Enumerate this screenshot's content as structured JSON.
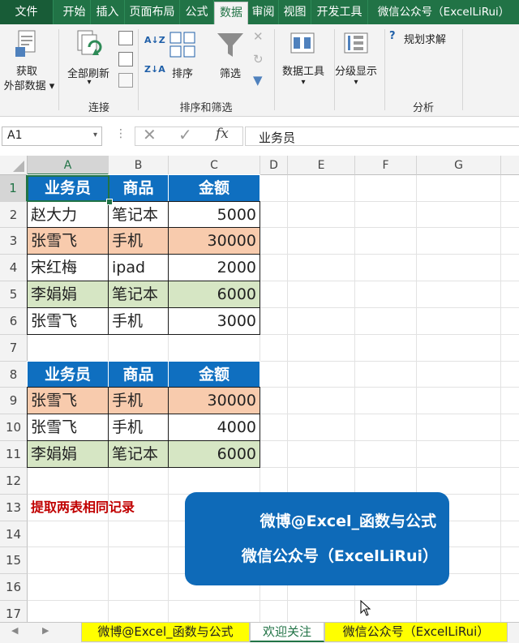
{
  "ribbon_tabs": [
    "文件",
    "开始",
    "插入",
    "页面布局",
    "公式",
    "数据",
    "审阅",
    "视图",
    "开发工具",
    "微信公众号（ExcelLiRui）"
  ],
  "ribbon": {
    "get_external_1": "获取",
    "get_external_2": "外部数据",
    "refresh_all": "全部刷新",
    "group_connections": "连接",
    "sort": "排序",
    "filter": "筛选",
    "group_sort_filter": "排序和筛选",
    "data_tools": "数据工具",
    "outline": "分级显示",
    "solver": "规划求解",
    "group_analysis": "分析",
    "sort_az_icon": "A↓Z",
    "sort_za_icon": "Z↓A"
  },
  "formula_bar": {
    "name_box": "A1",
    "fx": "fx",
    "content": "业务员"
  },
  "columns": [
    "A",
    "B",
    "C",
    "D",
    "E",
    "F",
    "G"
  ],
  "rows": [
    "1",
    "2",
    "3",
    "4",
    "5",
    "6",
    "7",
    "8",
    "9",
    "10",
    "11",
    "12",
    "13",
    "14",
    "15",
    "16",
    "17"
  ],
  "table1": {
    "headers": [
      "业务员",
      "商品",
      "金额"
    ],
    "rows": [
      [
        "赵大力",
        "笔记本",
        "5000"
      ],
      [
        "张雪飞",
        "手机",
        "30000"
      ],
      [
        "宋红梅",
        "ipad",
        "2000"
      ],
      [
        "李娟娟",
        "笔记本",
        "6000"
      ],
      [
        "张雪飞",
        "手机",
        "3000"
      ]
    ]
  },
  "table2": {
    "headers": [
      "业务员",
      "商品",
      "金额"
    ],
    "rows": [
      [
        "张雪飞",
        "手机",
        "30000"
      ],
      [
        "张雪飞",
        "手机",
        "4000"
      ],
      [
        "李娟娟",
        "笔记本",
        "6000"
      ]
    ]
  },
  "note": "提取两表相同记录",
  "banner": {
    "line1": "微博@Excel_函数与公式",
    "line2": "微信公众号（ExcelLiRui）"
  },
  "sheets": [
    "微博@Excel_函数与公式",
    "欢迎关注",
    "微信公众号（ExcelLiRui）"
  ],
  "colors": {
    "excel_green": "#217346",
    "header_blue": "#0f6fc0",
    "highlight_orange": "#f8cbad",
    "highlight_green": "#d6e6c4",
    "note_red": "#c00000",
    "banner_blue": "#0e6ab8",
    "sheet_tab_yellow": "#ffff00"
  }
}
